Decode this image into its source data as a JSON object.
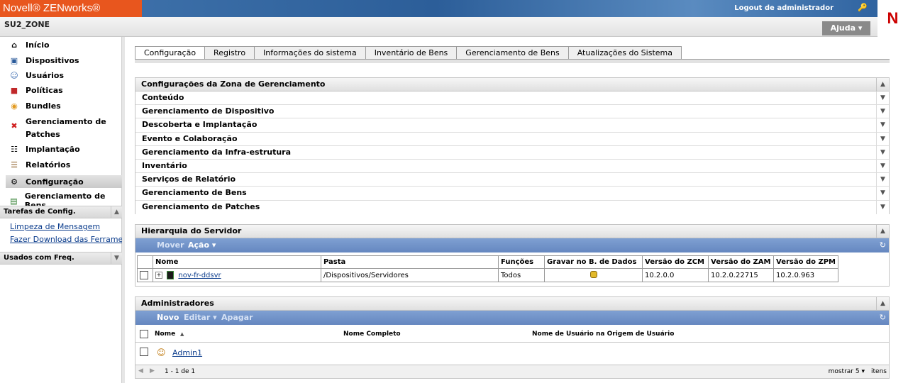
{
  "header": {
    "brand": "Novell® ZENworks®",
    "logout": "Logout de administrador",
    "zone": "SU2_ZONE",
    "help": "Ajuda ▾",
    "logo_letter": "N",
    "brand_color": "#e8561e"
  },
  "nav": {
    "items": [
      {
        "label": "Início",
        "icon": "home-icon"
      },
      {
        "label": "Dispositivos",
        "icon": "monitor-icon"
      },
      {
        "label": "Usuários",
        "icon": "user-icon"
      },
      {
        "label": "Políticas",
        "icon": "policy-icon"
      },
      {
        "label": "Bundles",
        "icon": "bundle-icon"
      },
      {
        "label_line1": "Gerenciamento de",
        "label_line2": "Patches",
        "icon": "patch-icon"
      },
      {
        "label": "Implantação",
        "icon": "deploy-icon"
      },
      {
        "label": "Relatórios",
        "icon": "report-icon"
      },
      {
        "label": "Configuração",
        "icon": "gear-icon",
        "selected": true
      },
      {
        "label": "Gerenciamento de Bens",
        "icon": "asset-icon"
      }
    ],
    "tasks_title": "Tarefas de Config.",
    "tasks": [
      "Limpeza de Mensagem",
      "Fazer Download das Ferramentas"
    ],
    "freq_title": "Usados com Freq."
  },
  "tabs": [
    "Configuração",
    "Registro",
    "Informações do sistema",
    "Inventário de Bens",
    "Gerenciamento de Bens",
    "Atualizações do Sistema"
  ],
  "zone_settings": {
    "title": "Configurações da Zona de Gerenciamento",
    "rows": [
      "Conteúdo",
      "Gerenciamento de Dispositivo",
      "Descoberta e Implantação",
      "Evento e Colaboração",
      "Gerenciamento da Infra-estrutura",
      "Inventário",
      "Serviços de Relatório",
      "Gerenciamento de Bens",
      "Gerenciamento de Patches"
    ]
  },
  "server_hierarchy": {
    "title": "Hierarquia do Servidor",
    "actions": {
      "move": "Mover",
      "action": "Ação ▾"
    },
    "columns": [
      "Nome",
      "Pasta",
      "Funções",
      "Gravar no B. de Dados",
      "Versão do ZCM",
      "Versão do ZAM",
      "Versão do ZPM"
    ],
    "rows": [
      {
        "name": "nov-fr-ddsvr",
        "folder": "/Dispositivos/Servidores",
        "roles": "Todos",
        "zcm": "10.2.0.0",
        "zam": "10.2.0.22715",
        "zpm": "10.2.0.963"
      }
    ]
  },
  "admins": {
    "title": "Administradores",
    "actions": {
      "new": "Novo",
      "edit": "Editar ▾",
      "delete": "Apagar"
    },
    "columns": {
      "name": "Nome",
      "sort": "▲",
      "full_name": "Nome Completo",
      "source_user": "Nome de Usuário na Origem de Usuário"
    },
    "rows": [
      {
        "name": "Admin1"
      }
    ],
    "pager": {
      "range": "1 - 1 de 1",
      "show": "mostrar",
      "count": "5 ▾",
      "items": "itens"
    }
  }
}
